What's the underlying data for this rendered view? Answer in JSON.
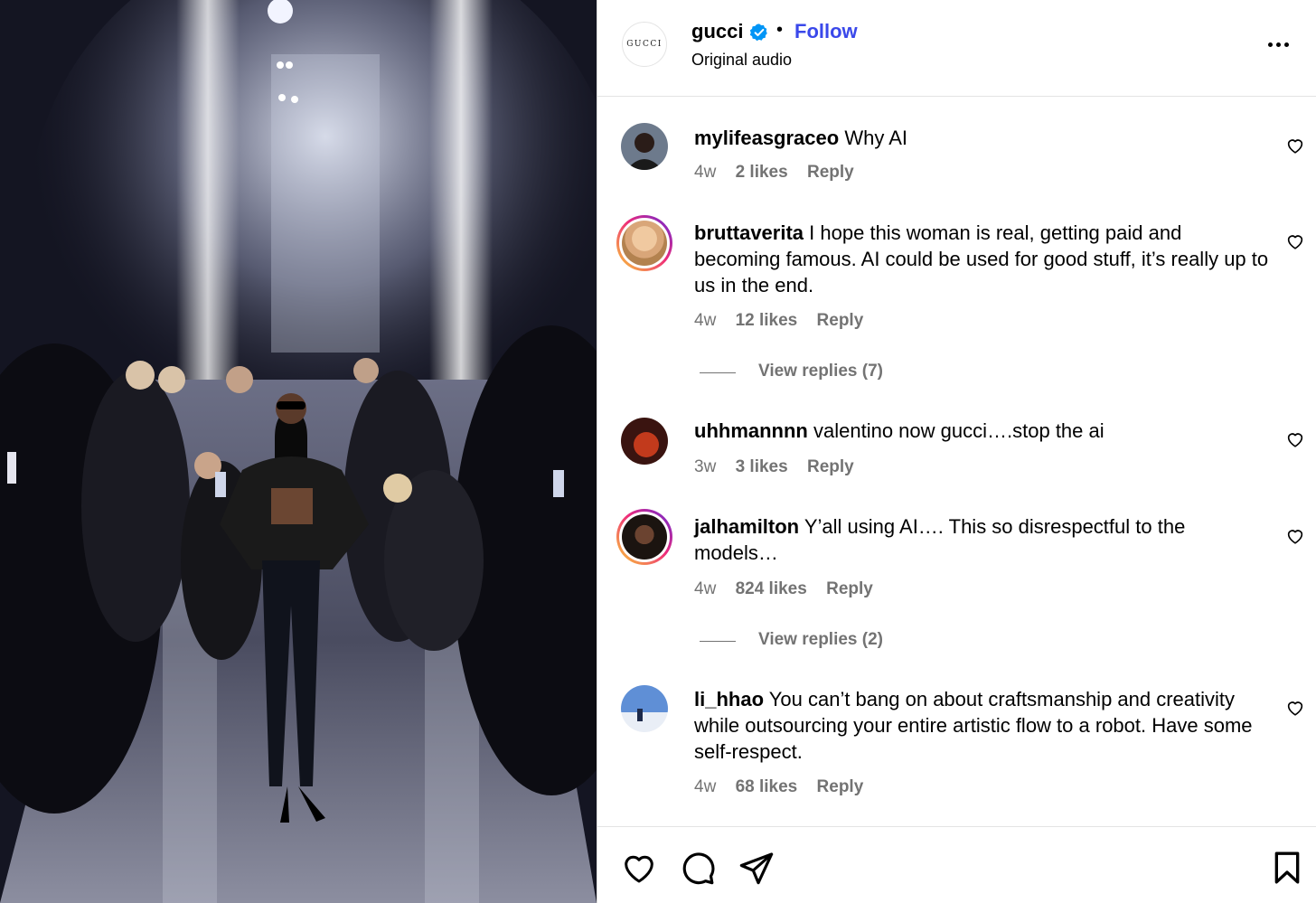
{
  "post": {
    "account": "gucci",
    "avatar_text": "GUCCI",
    "follow_label": "Follow",
    "separator": "•",
    "audio": "Original audio",
    "media_description_icon": "video-frame"
  },
  "comments": [
    {
      "user": "mylifeasgraceo",
      "text": "Why AI",
      "time": "4w",
      "likes": "2 likes",
      "reply": "Reply",
      "has_story_ring": false
    },
    {
      "user": "bruttaverita",
      "text": "I hope this woman is real, getting paid and becoming famous. AI could be used for good stuff, it’s really up to us in the end.",
      "time": "4w",
      "likes": "12 likes",
      "reply": "Reply",
      "has_story_ring": true,
      "view_replies": "View replies (7)"
    },
    {
      "user": "uhhmannnn",
      "text": "valentino now gucci….stop the ai",
      "time": "3w",
      "likes": "3 likes",
      "reply": "Reply",
      "has_story_ring": false
    },
    {
      "user": "jalhamilton",
      "text": "Y’all using AI…. This so disrespectful to the models…",
      "time": "4w",
      "likes": "824 likes",
      "reply": "Reply",
      "has_story_ring": true,
      "view_replies": "View replies (2)"
    },
    {
      "user": "li_hhao",
      "text": "You can’t bang on about craftsmanship and creativity while outsourcing your entire artistic flow to a robot. Have some self-respect.",
      "time": "4w",
      "likes": "68 likes",
      "reply": "Reply",
      "has_story_ring": false
    }
  ],
  "footer_icons": [
    "heart-icon",
    "comment-icon",
    "share-icon",
    "bookmark-icon"
  ],
  "colors": {
    "follow": "#3a48ea",
    "verified": "#0095f6",
    "meta_text": "#737373"
  }
}
